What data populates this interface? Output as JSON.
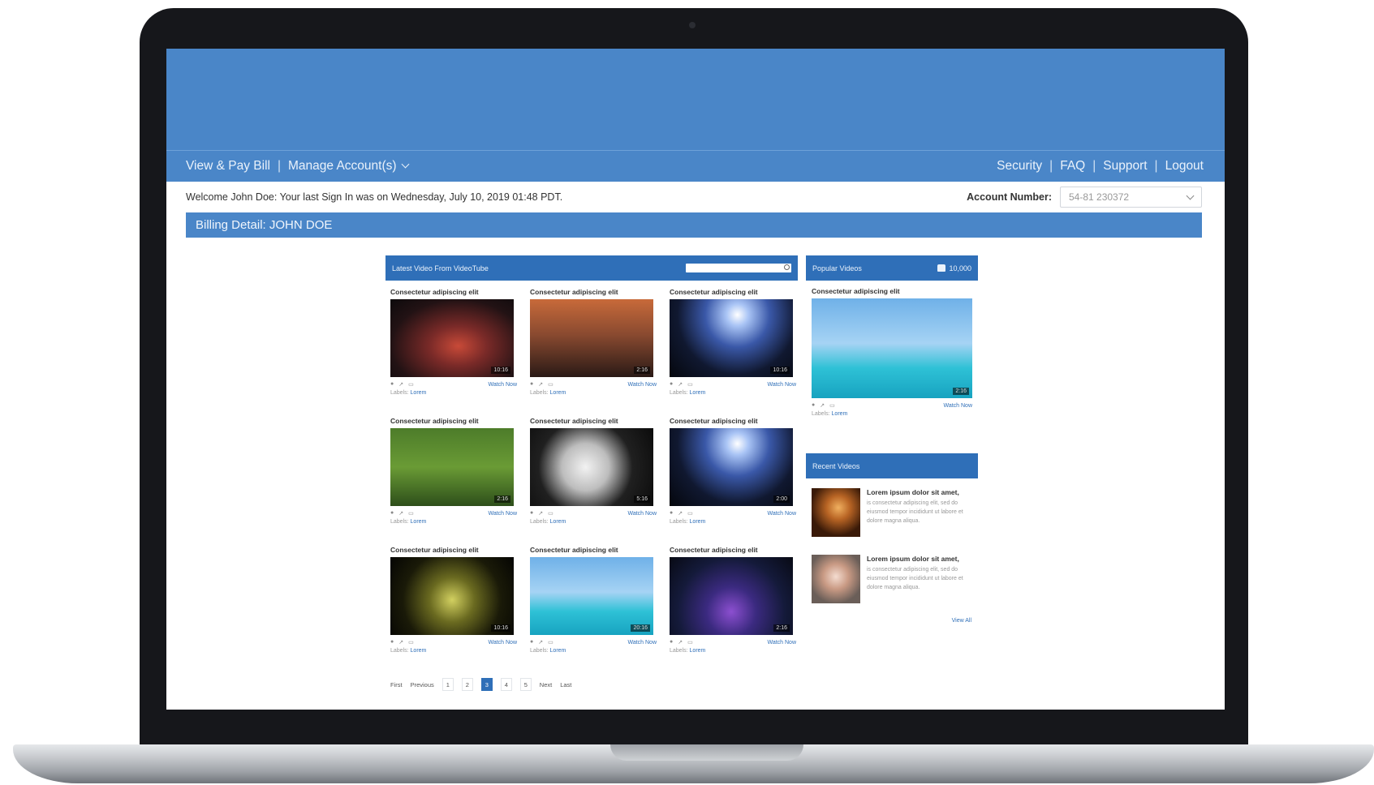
{
  "nav": {
    "left": [
      {
        "label": "View & Pay Bill"
      },
      {
        "label": "Manage Account(s)"
      }
    ],
    "separator": "|",
    "right": [
      {
        "label": "Security"
      },
      {
        "label": "FAQ"
      },
      {
        "label": "Support"
      },
      {
        "label": "Logout"
      }
    ]
  },
  "welcome": "Welcome John Doe: Your last Sign In was on Wednesday, July 10, 2019 01:48 PDT.",
  "account": {
    "label": "Account Number:",
    "value": "54-81 230372"
  },
  "billing_title": "Billing Detail: JOHN DOE",
  "latest": {
    "title": "Latest Video From VideoTube",
    "cards": [
      {
        "title": "Consectetur adipiscing elit",
        "duration": "10:16",
        "watch": "Watch Now",
        "labels": "Labels:",
        "label_link": "Lorem"
      },
      {
        "title": "Consectetur adipiscing elit",
        "duration": "2:16",
        "watch": "Watch Now",
        "labels": "Labels:",
        "label_link": "Lorem"
      },
      {
        "title": "Consectetur adipiscing elit",
        "duration": "10:16",
        "watch": "Watch Now",
        "labels": "Labels:",
        "label_link": "Lorem"
      },
      {
        "title": "Consectetur adipiscing elit",
        "duration": "2:16",
        "watch": "Watch Now",
        "labels": "Labels:",
        "label_link": "Lorem"
      },
      {
        "title": "Consectetur adipiscing elit",
        "duration": "5:16",
        "watch": "Watch Now",
        "labels": "Labels:",
        "label_link": "Lorem"
      },
      {
        "title": "Consectetur adipiscing elit",
        "duration": "2:00",
        "watch": "Watch Now",
        "labels": "Labels:",
        "label_link": "Lorem"
      },
      {
        "title": "Consectetur adipiscing elit",
        "duration": "10:16",
        "watch": "Watch Now",
        "labels": "Labels:",
        "label_link": "Lorem"
      },
      {
        "title": "Consectetur adipiscing elit",
        "duration": "20:16",
        "watch": "Watch Now",
        "labels": "Labels:",
        "label_link": "Lorem"
      },
      {
        "title": "Consectetur adipiscing elit",
        "duration": "2:16",
        "watch": "Watch Now",
        "labels": "Labels:",
        "label_link": "Lorem"
      }
    ]
  },
  "pager": {
    "first": "First",
    "previous": "Previous",
    "pages": [
      "1",
      "2",
      "3",
      "4",
      "5"
    ],
    "current": "3",
    "next": "Next",
    "last": "Last"
  },
  "popular": {
    "title": "Popular Videos",
    "likes": "10,000",
    "card": {
      "title": "Consectetur adipiscing elit",
      "duration": "2:16",
      "watch": "Watch Now",
      "labels": "Labels:",
      "label_link": "Lorem"
    }
  },
  "recent": {
    "title": "Recent Videos",
    "items": [
      {
        "title": "Lorem ipsum dolor sit amet,",
        "text": "is consectetur adipiscing elit, sed do eiusmod tempor incididunt ut labore et dolore magna aliqua."
      },
      {
        "title": "Lorem ipsum dolor sit amet,",
        "text": "is consectetur adipiscing elit, sed do eiusmod tempor incididunt ut labore et dolore magna aliqua."
      }
    ],
    "view_all": "View All"
  },
  "colors": {
    "brand": "#4a86c8",
    "panel": "#2f6fb8"
  }
}
